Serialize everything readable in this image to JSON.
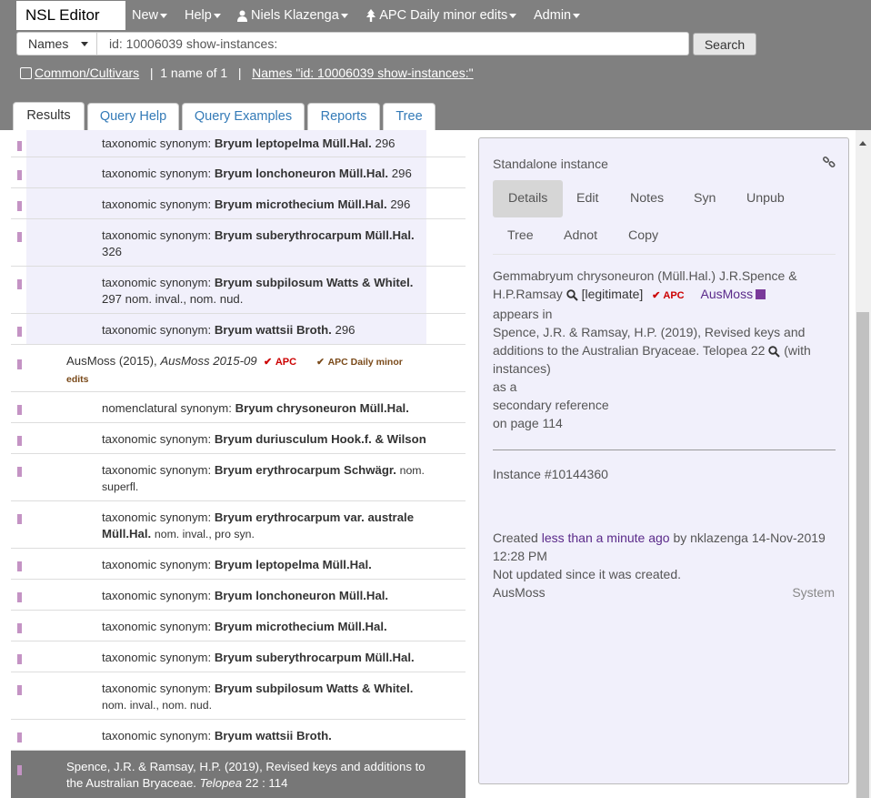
{
  "app": {
    "brand": "NSL Editor"
  },
  "nav": {
    "new": "New",
    "help": "Help",
    "user": "Niels Klazenga",
    "tree": "APC Daily minor edits",
    "admin": "Admin"
  },
  "search": {
    "scope": "Names",
    "query": "id: 10006039 show-instances:",
    "button": "Search"
  },
  "status": {
    "common_cultivars": "Common/Cultivars",
    "sep1": "|",
    "count": "1 name of 1",
    "sep2": "|",
    "names_link": "Names \"id: 10006039 show-instances:\""
  },
  "tabs": [
    "Results",
    "Query Help",
    "Query Examples",
    "Reports",
    "Tree"
  ],
  "results": {
    "upper": [
      {
        "prefix": "taxonomic synonym:",
        "name": "Bryum leptopelma Müll.Hal.",
        "suffix": "296"
      },
      {
        "prefix": "taxonomic synonym:",
        "name": "Bryum lonchoneuron Müll.Hal.",
        "suffix": "296"
      },
      {
        "prefix": "taxonomic synonym:",
        "name": "Bryum microthecium Müll.Hal.",
        "suffix": "296"
      },
      {
        "prefix": "taxonomic synonym:",
        "name": "Bryum suberythrocarpum Müll.Hal.",
        "suffix": "326"
      },
      {
        "prefix": "taxonomic synonym:",
        "name": "Bryum subpilosum Watts & Whitel.",
        "suffix": "297 nom. inval., nom. nud."
      },
      {
        "prefix": "taxonomic synonym:",
        "name": "Bryum wattsii Broth.",
        "suffix": "296"
      }
    ],
    "ref": {
      "text": "AusMoss (2015), ",
      "italic": "AusMoss 2015-09",
      "apc": "APC",
      "apc_daily": "APC Daily minor",
      "edits": "edits"
    },
    "lower": [
      {
        "prefix": "nomenclatural synonym:",
        "name": "Bryum chrysoneuron Müll.Hal.",
        "suffix": ""
      },
      {
        "prefix": "taxonomic synonym:",
        "name": "Bryum duriusculum Hook.f. & Wilson",
        "suffix": ""
      },
      {
        "prefix": "taxonomic synonym:",
        "name": "Bryum erythrocarpum Schwägr.",
        "suffix": "nom.",
        "suffix2": "superfl."
      },
      {
        "prefix": "taxonomic synonym:",
        "name": "Bryum erythrocarpum var. australe",
        "name2": "Müll.Hal.",
        "suffix": "nom. inval., pro syn."
      },
      {
        "prefix": "taxonomic synonym:",
        "name": "Bryum leptopelma Müll.Hal.",
        "suffix": ""
      },
      {
        "prefix": "taxonomic synonym:",
        "name": "Bryum lonchoneuron Müll.Hal.",
        "suffix": ""
      },
      {
        "prefix": "taxonomic synonym:",
        "name": "Bryum microthecium Müll.Hal.",
        "suffix": ""
      },
      {
        "prefix": "taxonomic synonym:",
        "name": "Bryum suberythrocarpum Müll.Hal.",
        "suffix": ""
      },
      {
        "prefix": "taxonomic synonym:",
        "name": "Bryum subpilosum Watts & Whitel.",
        "suffix": "",
        "suffix2": "nom. inval., nom. nud."
      },
      {
        "prefix": "taxonomic synonym:",
        "name": "Bryum wattsii Broth.",
        "suffix": ""
      }
    ],
    "selected": {
      "line1": "Spence, J.R. & Ramsay, H.P. (2019), Revised keys and additions to",
      "line2a": "the Australian Bryaceae. ",
      "italic": "Telopea",
      "line2b": " 22 : 114"
    }
  },
  "detail": {
    "title": "Standalone instance",
    "tabs": [
      "Details",
      "Edit",
      "Notes",
      "Syn",
      "Unpub",
      "Tree",
      "Adnot",
      "Copy"
    ],
    "name_line1": "Gemmabryum chrysoneuron (Müll.Hal.) J.R.Spence &",
    "name_line2": "H.P.Ramsay",
    "legit": "[legitimate]",
    "apc": "APC",
    "ausmoss": "AusMoss",
    "appears_in": "appears in",
    "ref_line1": "Spence, J.R. & Ramsay, H.P. (2019), Revised keys and",
    "ref_line2": "additions to the Australian Bryaceae. Telopea 22",
    "with": "(with",
    "instances": "instances)",
    "as_a": "as a",
    "secondary": "secondary reference",
    "page": "on page 114",
    "instance_id": "Instance #10144360",
    "created_prefix": "Created ",
    "created_ago": "less than a minute ago",
    "created_suffix": " by nklazenga 14-Nov-2019",
    "created_time": "12:28 PM",
    "not_updated": "Not updated since it was created.",
    "source": "AusMoss",
    "system": "System"
  },
  "colors": {
    "header": "#808080",
    "panel": "#f1f0fb",
    "marker": "#c493c4",
    "apc": "#cc0000",
    "link_purple": "#5a2a8a"
  }
}
